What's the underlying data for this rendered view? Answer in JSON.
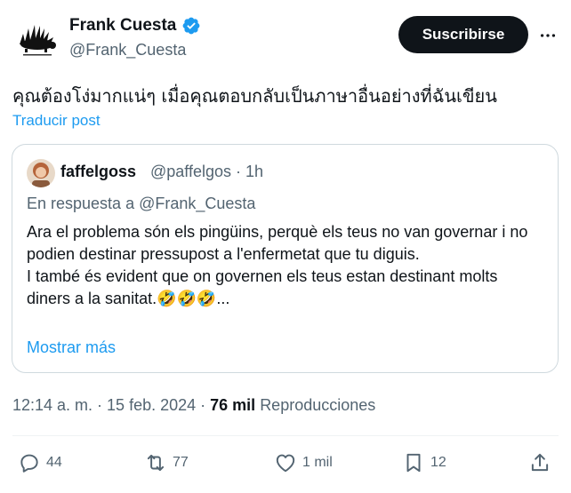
{
  "author": {
    "display_name": "Frank Cuesta",
    "handle": "@Frank_Cuesta"
  },
  "subscribe_label": "Suscribirse",
  "tweet_text": "คุณต้องโง่มากแน่ๆ เมื่อคุณตอบกลับเป็นภาษาอื่นอย่างที่ฉันเขียน",
  "translate_label": "Traducir post",
  "quoted": {
    "display_name": "faffelgoss",
    "meta": "@paffelgos · 1h",
    "reply_prefix": "En respuesta a",
    "reply_mention": "@Frank_Cuesta",
    "body_line1": "Ara el problema són els pingüins, perquè els teus no van governar i no podien destinar pressupost a l'enfermetat que tu diguis.",
    "body_line2": "I també és evident que on governen els teus estan destinant molts diners a la sanitat.🤣🤣🤣...",
    "show_more": "Mostrar más"
  },
  "meta": {
    "time": "12:14 a. m. · 15 feb. 2024 · ",
    "views_count": "76 mil",
    "views_label": "Reproducciones"
  },
  "actions": {
    "replies": "44",
    "reposts": "77",
    "likes": "1 mil",
    "bookmarks": "12"
  },
  "colors": {
    "accent": "#1d9bf0",
    "text": "#0f1419",
    "secondary": "#536471",
    "border": "#cfd9de"
  }
}
